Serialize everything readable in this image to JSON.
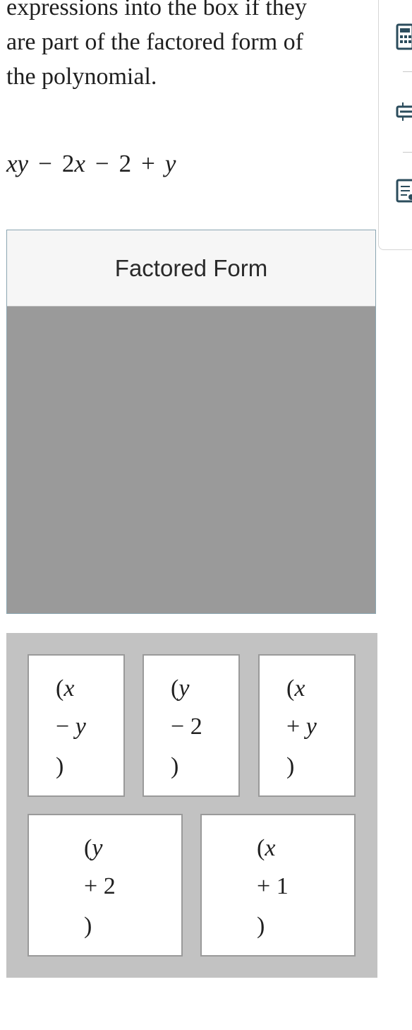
{
  "prompt": {
    "line1": "expressions into the box if they",
    "line2": "are part of the factored form of",
    "line3": "the polynomial."
  },
  "expression": {
    "t1": "xy",
    "op1": "−",
    "t2a": "2",
    "t2b": "x",
    "op2": "−",
    "t3": "2",
    "op3": "+",
    "t4": "y"
  },
  "toolbar": {
    "tools": [
      "calculator-icon",
      "reference-icon",
      "notepad-icon"
    ]
  },
  "dropzone": {
    "header": "Factored Form"
  },
  "tiles": [
    {
      "open": "(",
      "var": "x",
      "op": "−",
      "term": "y",
      "term_italic": true,
      "close": ")"
    },
    {
      "open": "(",
      "var": "y",
      "op": "−",
      "term": "2",
      "term_italic": false,
      "close": ")"
    },
    {
      "open": "(",
      "var": "x",
      "op": "+",
      "term": "y",
      "term_italic": true,
      "close": ")"
    },
    {
      "open": "(",
      "var": "y",
      "op": "+",
      "term": "2",
      "term_italic": false,
      "close": ")"
    },
    {
      "open": "(",
      "var": "x",
      "op": "+",
      "term": "1",
      "term_italic": false,
      "close": ")"
    }
  ]
}
